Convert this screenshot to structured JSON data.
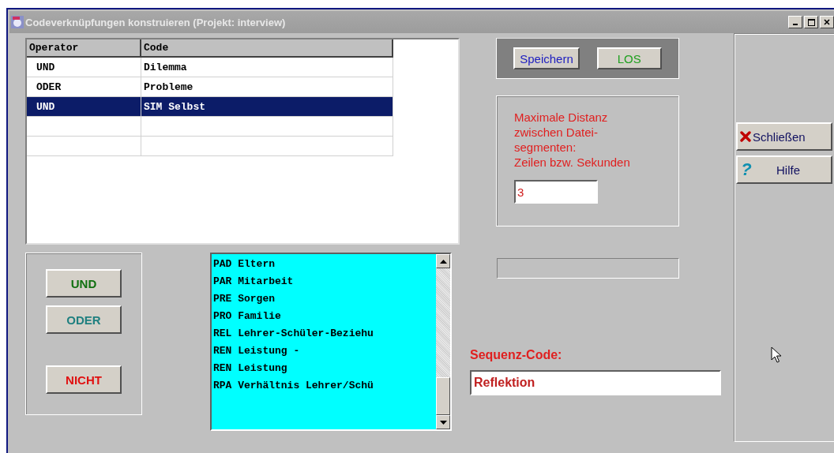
{
  "window": {
    "title": "Codeverknüpfungen konstruieren (Projekt: interview)"
  },
  "table": {
    "columns": [
      "Operator",
      "Code"
    ],
    "rows": [
      {
        "operator": "UND",
        "code": "Dilemma",
        "selected": false
      },
      {
        "operator": "ODER",
        "code": "Probleme",
        "selected": false
      },
      {
        "operator": "UND",
        "code": "SIM Selbst",
        "selected": true
      },
      {
        "operator": "",
        "code": "",
        "selected": false
      },
      {
        "operator": "",
        "code": "",
        "selected": false
      }
    ]
  },
  "operator_buttons": [
    {
      "label": "UND",
      "color": "#107010"
    },
    {
      "label": "ODER",
      "color": "#208080"
    },
    {
      "label": "NICHT",
      "color": "#e01010"
    }
  ],
  "code_list": [
    "PAD Eltern",
    "PAR Mitarbeit",
    "PRE Sorgen",
    "PRO Familie",
    "REL Lehrer-Schüler-Beziehu",
    "REN Leistung -",
    "REN Leistung",
    "RPA Verhältnis Lehrer/Schü"
  ],
  "action_buttons": [
    {
      "label": "Speichern",
      "color": "#2020c0"
    },
    {
      "label": "LOS",
      "color": "#20a020"
    }
  ],
  "distance": {
    "lines": [
      "Maximale Distanz",
      "zwischen Datei-",
      "segmenten:",
      "Zeilen bzw. Sekunden"
    ],
    "value": "3"
  },
  "progress": {
    "level": 0
  },
  "sequence": {
    "label": "Sequenz-Code:",
    "value": "Reflektion"
  },
  "side_buttons": [
    {
      "label": "Schließen",
      "kind": "close"
    },
    {
      "label": "Hilfe",
      "kind": "help",
      "icon": "?"
    }
  ]
}
